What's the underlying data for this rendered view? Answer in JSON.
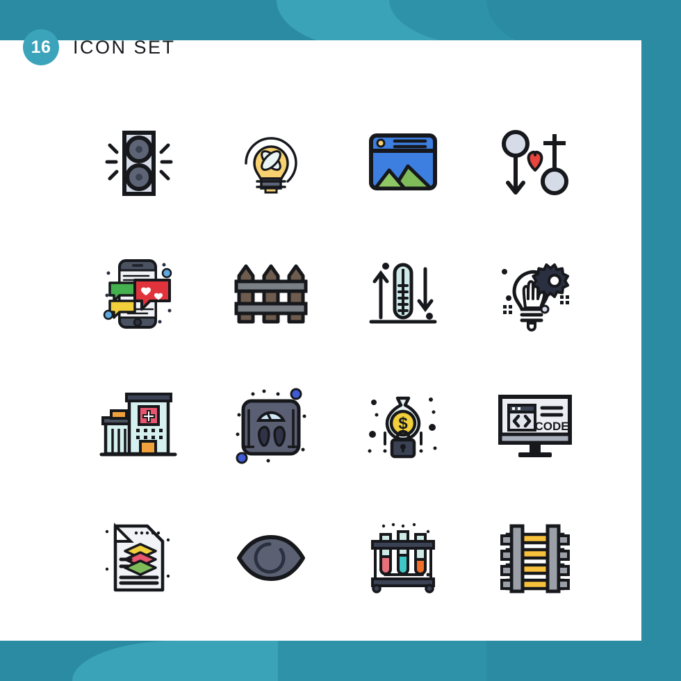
{
  "header": {
    "count": "16",
    "title": "ICON SET"
  },
  "theme": {
    "teal_light": "#3aa3b8",
    "teal_mid": "#2e93a8",
    "teal_dark": "#2b8ba3",
    "badge": "#3ba4ba",
    "card_bg": "#ffffff",
    "outline": "#16181c"
  },
  "grid": {
    "columns": 4,
    "rows": 4,
    "icons": [
      {
        "index": 1,
        "name": "speaker-icon",
        "label": "Speaker",
        "colors": [
          "#d6dbe8",
          "#5d6475",
          "#16181c"
        ]
      },
      {
        "index": 2,
        "name": "idea-bulb-icon",
        "label": "Light Bulb Idea",
        "colors": [
          "#f7d070",
          "#e9f4f4",
          "#5d6475"
        ]
      },
      {
        "index": 3,
        "name": "image-gallery-icon",
        "label": "Image Gallery",
        "colors": [
          "#3d7fe0",
          "#80bb5a",
          "#f7d070"
        ]
      },
      {
        "index": 4,
        "name": "gender-love-icon",
        "label": "Gender Love",
        "colors": [
          "#d6dbe8",
          "#e8453c",
          "#16181c"
        ]
      },
      {
        "index": 5,
        "name": "mobile-chat-icon",
        "label": "Mobile Chat",
        "colors": [
          "#45b04e",
          "#f2d03b",
          "#e0333b",
          "#4a5160"
        ]
      },
      {
        "index": 6,
        "name": "fence-icon",
        "label": "Fence",
        "colors": [
          "#6e5c4e",
          "#7b8086",
          "#16181c"
        ]
      },
      {
        "index": 7,
        "name": "thermometer-icon",
        "label": "Thermometer",
        "colors": [
          "#cfeae6",
          "#16181c"
        ]
      },
      {
        "index": 8,
        "name": "bulb-gear-icon",
        "label": "Innovation Gear",
        "colors": [
          "#16181c",
          "#ffffff"
        ]
      },
      {
        "index": 9,
        "name": "hospital-icon",
        "label": "Hospital",
        "colors": [
          "#d6f0ef",
          "#e8556f",
          "#f0a13c"
        ]
      },
      {
        "index": 10,
        "name": "weight-scale-icon",
        "label": "Weight Scale",
        "colors": [
          "#5b5f73",
          "#2f3345",
          "#cfe6f5",
          "#3f5bd6"
        ]
      },
      {
        "index": 11,
        "name": "secure-money-icon",
        "label": "Secure Money",
        "colors": [
          "#f2d03b",
          "#3b4254",
          "#e9f4f4"
        ]
      },
      {
        "index": 12,
        "name": "code-monitor-icon",
        "label": "Code Monitor",
        "text": "CODE",
        "colors": [
          "#eceef3",
          "#d6dbe8",
          "#16181c"
        ]
      },
      {
        "index": 13,
        "name": "document-layers-icon",
        "label": "Document Layers",
        "colors": [
          "#f2f3f6",
          "#f2d03b",
          "#e8556f",
          "#80bb5a"
        ]
      },
      {
        "index": 14,
        "name": "eye-icon",
        "label": "Eye",
        "colors": [
          "#5b6173",
          "#3f4455"
        ]
      },
      {
        "index": 15,
        "name": "test-tubes-icon",
        "label": "Test Tubes",
        "colors": [
          "#cfeae6",
          "#e8707a",
          "#3fc6c6",
          "#f0702a"
        ]
      },
      {
        "index": 16,
        "name": "railroad-track-icon",
        "label": "Railroad Track",
        "colors": [
          "#f7c13b",
          "#9ba0a8",
          "#16181c"
        ]
      }
    ]
  }
}
